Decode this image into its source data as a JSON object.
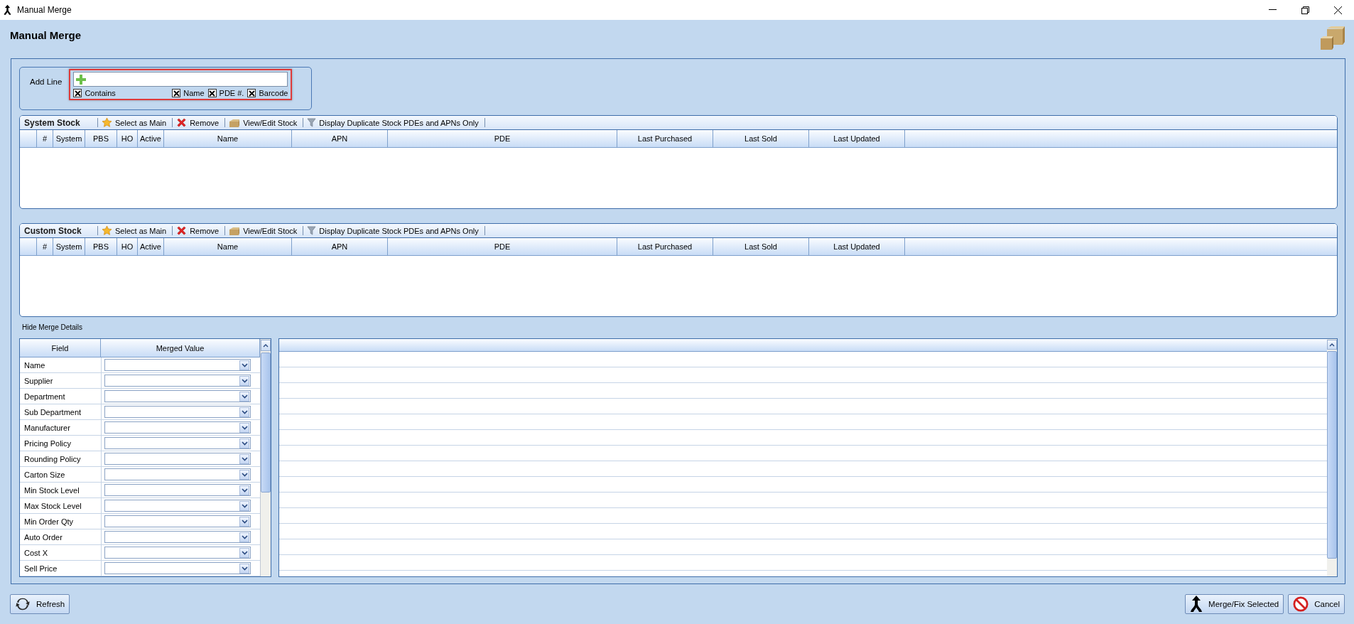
{
  "window": {
    "title": "Manual Merge"
  },
  "page_title": "Manual Merge",
  "add_line": {
    "label": "Add Line",
    "highlighted": true,
    "options": [
      {
        "label": "Contains",
        "checked": true
      },
      {
        "label": "Name",
        "checked": true
      },
      {
        "label": "PDE #.",
        "checked": true
      },
      {
        "label": "Barcode",
        "checked": true
      }
    ]
  },
  "stock_panels": [
    {
      "title": "System Stock",
      "toolbar": [
        {
          "kind": "star",
          "label": "Select as Main"
        },
        {
          "kind": "remove",
          "label": "Remove"
        },
        {
          "kind": "box",
          "label": "View/Edit Stock"
        },
        {
          "kind": "filter",
          "label": "Display Duplicate Stock PDEs and APNs Only"
        }
      ],
      "columns": [
        "#",
        "System",
        "PBS",
        "HO",
        "Active",
        "Name",
        "APN",
        "PDE",
        "Last Purchased",
        "Last Sold",
        "Last Updated"
      ]
    },
    {
      "title": "Custom Stock",
      "toolbar": [
        {
          "kind": "star",
          "label": "Select as Main"
        },
        {
          "kind": "remove",
          "label": "Remove"
        },
        {
          "kind": "box",
          "label": "View/Edit Stock"
        },
        {
          "kind": "filter",
          "label": "Display Duplicate Stock PDEs and APNs Only"
        }
      ],
      "columns": [
        "#",
        "System",
        "PBS",
        "HO",
        "Active",
        "Name",
        "APN",
        "PDE",
        "Last Purchased",
        "Last Sold",
        "Last Updated"
      ]
    }
  ],
  "merge_details": {
    "toggle": "Hide Merge Details",
    "columns": [
      "Field",
      "Merged Value"
    ],
    "rows": [
      {
        "field": "Name"
      },
      {
        "field": "Supplier"
      },
      {
        "field": "Department"
      },
      {
        "field": "Sub Department"
      },
      {
        "field": "Manufacturer"
      },
      {
        "field": "Pricing Policy"
      },
      {
        "field": "Rounding Policy"
      },
      {
        "field": "Carton Size"
      },
      {
        "field": "Min Stock Level"
      },
      {
        "field": "Max Stock Level"
      },
      {
        "field": "Min Order Qty"
      },
      {
        "field": "Auto Order"
      },
      {
        "field": "Cost X"
      },
      {
        "field": "Sell Price"
      }
    ]
  },
  "buttons": [
    {
      "kind": "refresh",
      "label": "Refresh"
    },
    {
      "kind": "merge",
      "label": "Merge/Fix Selected"
    },
    {
      "kind": "cancel",
      "label": "Cancel"
    }
  ]
}
